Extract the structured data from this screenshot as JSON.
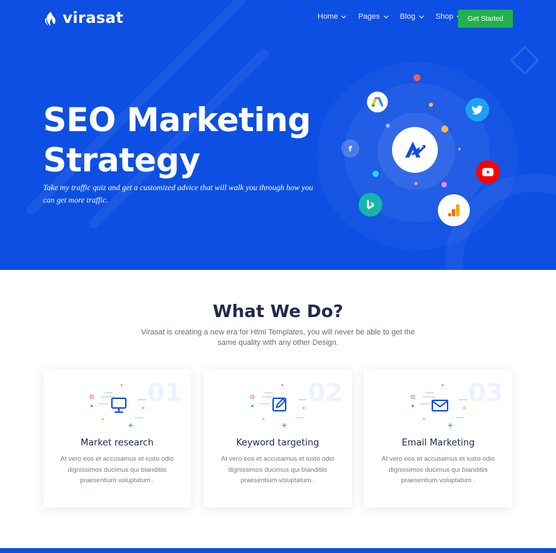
{
  "brand": {
    "name": "virasat",
    "accent": "#0d4fe3",
    "cta_color": "#22b14c"
  },
  "nav": {
    "items": [
      {
        "label": "Home"
      },
      {
        "label": "Pages"
      },
      {
        "label": "Blog"
      },
      {
        "label": "Shop"
      }
    ],
    "cta_label": "Get Started"
  },
  "hero": {
    "title_line1": "SEO Marketing",
    "title_line2": "Strategy",
    "subtitle": "Take my traffic quiz and get a customized advice that will walk you through how you can get more traffic.",
    "icons": [
      "google-ads-icon",
      "twitter-icon",
      "facebook-icon",
      "youtube-icon",
      "bing-icon",
      "analytics-icon",
      "center-logo-icon"
    ]
  },
  "services": {
    "title": "What We Do?",
    "description": "Virasat is creating a new era for Html Templates, you will never be able to get the same quality with any other Design.",
    "cards": [
      {
        "number": "01",
        "title": "Market research",
        "text": "At vero eos et accusamus et iusto odio dignissimos ducimus qui blanditiis praesentium voluptatum .",
        "icon": "monitor-icon"
      },
      {
        "number": "02",
        "title": "Keyword targeting",
        "text": "At vero eos et accusamus et iusto odio dignissimos ducimus qui blanditiis praesentium voluptatum .",
        "icon": "edit-icon"
      },
      {
        "number": "03",
        "title": "Email Marketing",
        "text": "At vero eos et accusamus et iusto odio dignissimos ducimus qui blanditiis praesentium voluptatum .",
        "icon": "envelope-icon"
      }
    ]
  }
}
